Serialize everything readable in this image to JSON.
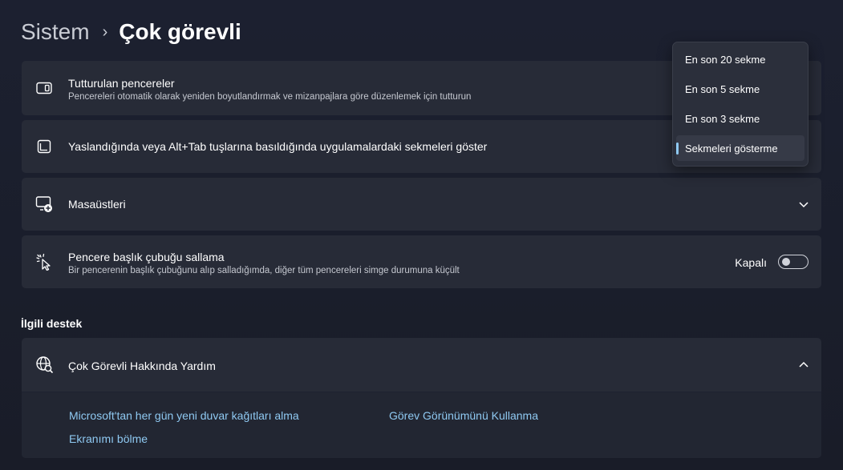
{
  "breadcrumb": {
    "parent": "Sistem",
    "separator": "›",
    "current": "Çok görevli"
  },
  "settings": {
    "snap": {
      "title": "Tutturulan pencereler",
      "description": "Pencereleri otomatik olarak yeniden boyutlandırmak ve mizanpajlara göre düzenlemek için tutturun",
      "icon": "snap-layout-icon"
    },
    "tabs": {
      "title": "Yaslandığında veya Alt+Tab tuşlarına basıldığında uygulamalardaki sekmeleri göster",
      "icon": "tabs-icon"
    },
    "desktops": {
      "title": "Masaüstleri",
      "icon": "add-desktop-icon"
    },
    "shake": {
      "title": "Pencere başlık çubuğu sallama",
      "description": "Bir pencerenin başlık çubuğunu alıp salladığımda, diğer tüm pencereleri simge durumuna küçült",
      "toggle_label": "Kapalı",
      "toggle_on": false,
      "icon": "shake-cursor-icon"
    }
  },
  "dropdown": {
    "options": [
      "En son 20 sekme",
      "En son 5 sekme",
      "En son 3 sekme",
      "Sekmeleri gösterme"
    ],
    "selected_index": 3
  },
  "related": {
    "heading": "İlgili destek",
    "help_title": "Çok Görevli Hakkında Yardım",
    "help_icon": "globe-search-icon",
    "links": [
      "Microsoft'tan her gün yeni duvar kağıtları alma",
      "Görev Görünümünü Kullanma",
      "Ekranımı bölme"
    ]
  },
  "colors": {
    "accent": "#8fc9f2",
    "card": "#272b37",
    "background": "#1b1f2b"
  }
}
